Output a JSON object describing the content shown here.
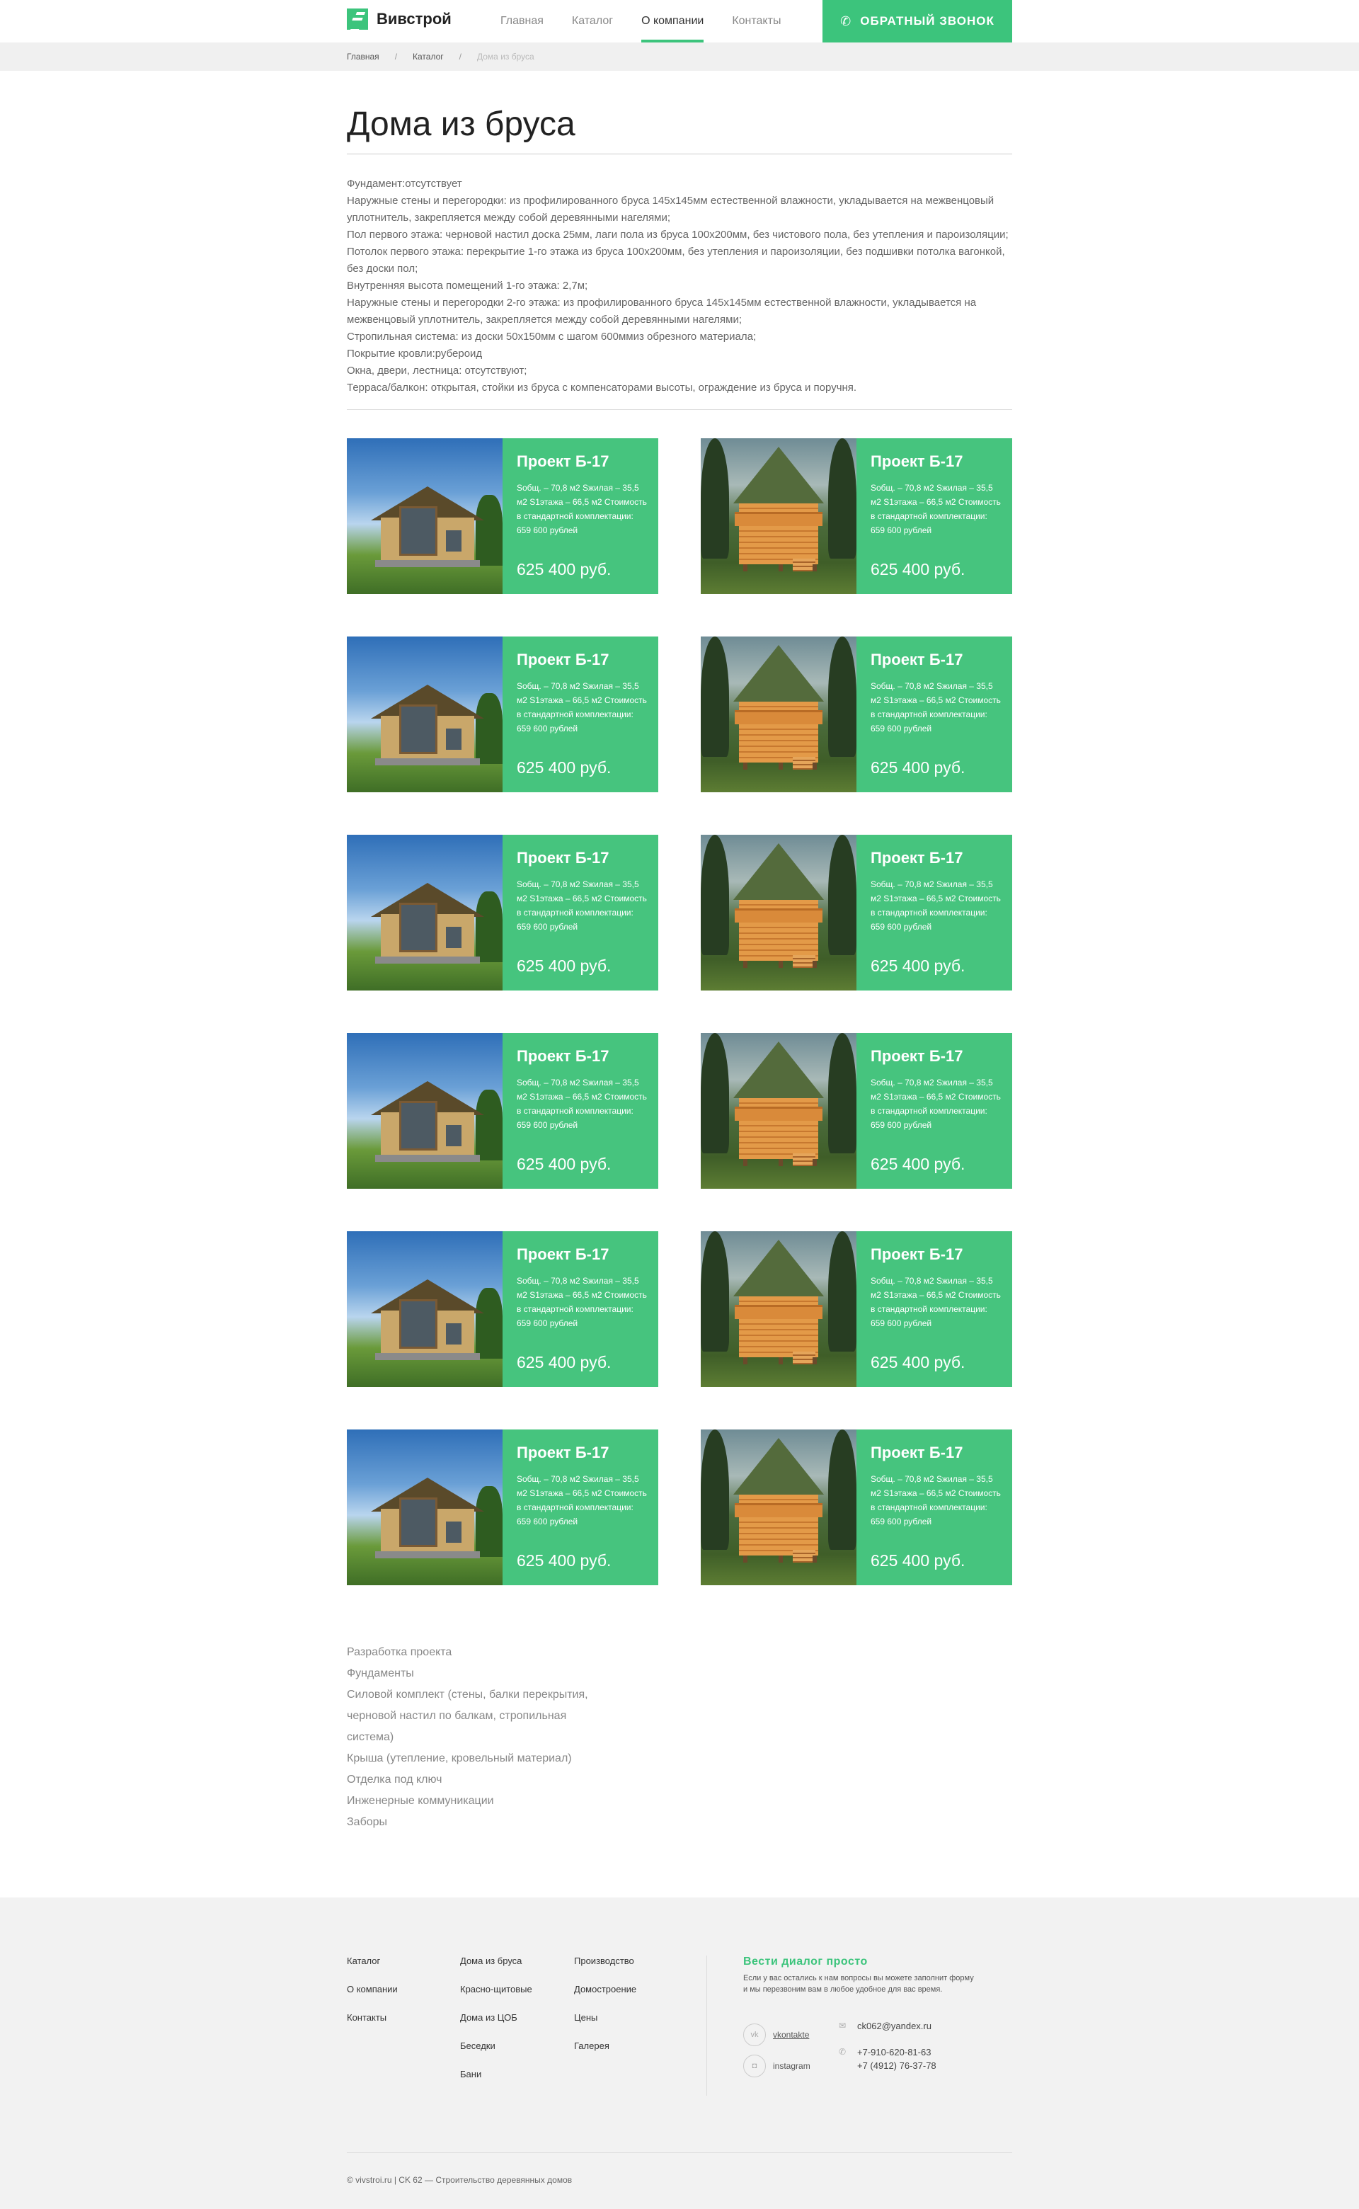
{
  "header": {
    "logo_text": "Вивстрой",
    "nav": [
      "Главная",
      "Каталог",
      "О компании",
      "Контакты"
    ],
    "active_nav": "О компании",
    "callback_label": "ОБРАТНЫЙ ЗВОНОК"
  },
  "breadcrumb": [
    "Главная",
    "Каталог",
    "Дома из бруса"
  ],
  "page_title": "Дома из бруса",
  "description": [
    "Фундамент:отсутствует",
    "Наружные стены и перегородки: из профилированного бруса 145х145мм естественной влажности, укладывается на межвенцовый уплотнитель, закрепляется между собой деревянными нагелями;",
    "Пол первого этажа: черновой настил доска 25мм, лаги пола из бруса 100х200мм, без чистового пола, без утепления и пароизоляции;",
    "Потолок первого этажа: перекрытие 1-го этажа из бруса 100х200мм, без утепления и пароизоляции, без подшивки потолка вагонкой, без доски пол;",
    "Внутренняя высота помещений 1-го этажа: 2,7м;",
    "Наружные стены и перегородки 2-го этажа: из профилированного бруса 145х145мм естественной влажности, укладывается на межвенцовый уплотнитель, закрепляется между собой деревянными нагелями;",
    "Стропильная система: из доски 50х150мм с шагом 600ммиз обрезного материала;",
    "Покрытие кровли:рубероид",
    "Окна, двери, лестница: отсутствуют;",
    "Терраса/балкон: открытая, стойки из бруса  с компенсаторами высоты, ограждение из бруса и поручня."
  ],
  "cards": [
    {
      "title": "Проект Б-17",
      "desc": "Sобщ. – 70,8 м2 Sжилая – 35,5 м2 S1этажа – 66,5 м2 Стоимость в стандартной комплектации: 659 600 рублей",
      "price": "625 400 руб.",
      "image": "modern-house"
    },
    {
      "title": "Проект Б-17",
      "desc": "Sобщ. – 70,8 м2 Sжилая – 35,5 м2 S1этажа – 66,5 м2 Стоимость в стандартной комплектации: 659 600 рублей",
      "price": "625 400 руб.",
      "image": "log-house"
    },
    {
      "title": "Проект Б-17",
      "desc": "Sобщ. – 70,8 м2 Sжилая – 35,5 м2 S1этажа – 66,5 м2 Стоимость в стандартной комплектации: 659 600 рублей",
      "price": "625 400 руб.",
      "image": "modern-house"
    },
    {
      "title": "Проект Б-17",
      "desc": "Sобщ. – 70,8 м2 Sжилая – 35,5 м2 S1этажа – 66,5 м2 Стоимость в стандартной комплектации: 659 600 рублей",
      "price": "625 400 руб.",
      "image": "log-house"
    },
    {
      "title": "Проект Б-17",
      "desc": "Sобщ. – 70,8 м2 Sжилая – 35,5 м2 S1этажа – 66,5 м2 Стоимость в стандартной комплектации: 659 600 рублей",
      "price": "625 400 руб.",
      "image": "modern-house"
    },
    {
      "title": "Проект Б-17",
      "desc": "Sобщ. – 70,8 м2 Sжилая – 35,5 м2 S1этажа – 66,5 м2 Стоимость в стандартной комплектации: 659 600 рублей",
      "price": "625 400 руб.",
      "image": "log-house"
    },
    {
      "title": "Проект Б-17",
      "desc": "Sобщ. – 70,8 м2 Sжилая – 35,5 м2 S1этажа – 66,5 м2 Стоимость в стандартной комплектации: 659 600 рублей",
      "price": "625 400 руб.",
      "image": "modern-house"
    },
    {
      "title": "Проект Б-17",
      "desc": "Sобщ. – 70,8 м2 Sжилая – 35,5 м2 S1этажа – 66,5 м2 Стоимость в стандартной комплектации: 659 600 рублей",
      "price": "625 400 руб.",
      "image": "log-house"
    },
    {
      "title": "Проект Б-17",
      "desc": "Sобщ. – 70,8 м2 Sжилая – 35,5 м2 S1этажа – 66,5 м2 Стоимость в стандартной комплектации: 659 600 рублей",
      "price": "625 400 руб.",
      "image": "modern-house"
    },
    {
      "title": "Проект Б-17",
      "desc": "Sобщ. – 70,8 м2 Sжилая – 35,5 м2 S1этажа – 66,5 м2 Стоимость в стандартной комплектации: 659 600 рублей",
      "price": "625 400 руб.",
      "image": "log-house"
    },
    {
      "title": "Проект Б-17",
      "desc": "Sобщ. – 70,8 м2 Sжилая – 35,5 м2 S1этажа – 66,5 м2 Стоимость в стандартной комплектации: 659 600 рублей",
      "price": "625 400 руб.",
      "image": "modern-house"
    },
    {
      "title": "Проект Б-17",
      "desc": "Sобщ. – 70,8 м2 Sжилая – 35,5 м2 S1этажа – 66,5 м2 Стоимость в стандартной комплектации: 659 600 рублей",
      "price": "625 400 руб.",
      "image": "log-house"
    }
  ],
  "services": [
    "Разработка проекта",
    "Фундаменты",
    "Силовой комплект (стены, балки перекрытия, черновой настил по балкам, стропильная система)",
    "Крыша (утепление, кровельный материал)",
    "Отделка под ключ",
    "Инженерные коммуникации",
    "Заборы"
  ],
  "footer": {
    "col1": [
      "Каталог",
      "О компании",
      "Контакты"
    ],
    "col2": [
      "Дома из бруса",
      "Красно-щитовые",
      "Дома из ЦОБ",
      "Беседки",
      "Бани"
    ],
    "col3": [
      "Производство",
      "Домостроение",
      "Цены",
      "Галерея"
    ],
    "contact_title": "Вести диалог просто",
    "contact_text": "Если у вас остались к нам вопросы вы можете заполнит форму и мы перезвоним вам в любое удобное для вас время.",
    "social": [
      {
        "icon": "vk-icon",
        "glyph": "vk",
        "label": "vkontakte"
      },
      {
        "icon": "instagram-icon",
        "glyph": "◘",
        "label": "instagram"
      }
    ],
    "email": "ck062@yandex.ru",
    "phone1": "+7-910-620-81-63",
    "phone2": "+7 (4912) 76-37-78",
    "copyright": "© vivstroi.ru | CK 62 — Строительство деревянных домов"
  },
  "colors": {
    "accent": "#3cc47c",
    "card_bg": "#46c47e",
    "breadcrumb_bg": "#f0f0f0",
    "footer_bg": "#f2f2f2"
  }
}
